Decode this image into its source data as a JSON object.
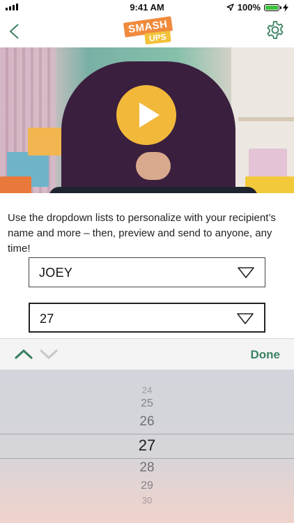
{
  "status_bar": {
    "time": "9:41 AM",
    "battery_percent": "100%",
    "battery_level": 1.0,
    "battery_color": "#3cc23b"
  },
  "nav": {
    "back_icon": "back-chevron-icon",
    "settings_icon": "gear-icon",
    "logo_line1": "SMASH",
    "logo_line2": "UPS"
  },
  "video": {
    "play_icon": "play-icon",
    "play_color": "#f2b83a"
  },
  "instructions": "Use the dropdown lists to personalize with your recipient’s name and more – then, preview and send to anyone, any time!",
  "dropdowns": [
    {
      "value": "JOEY",
      "icon": "dropdown-triangle-icon"
    },
    {
      "value": "27",
      "icon": "dropdown-triangle-icon"
    }
  ],
  "picker_toolbar": {
    "up_icon": "chevron-up-icon",
    "down_icon": "chevron-down-icon",
    "done_label": "Done",
    "accent": "#3c8261"
  },
  "picker": {
    "options": [
      "24",
      "25",
      "26",
      "27",
      "28",
      "29",
      "30"
    ],
    "selected": "27"
  }
}
